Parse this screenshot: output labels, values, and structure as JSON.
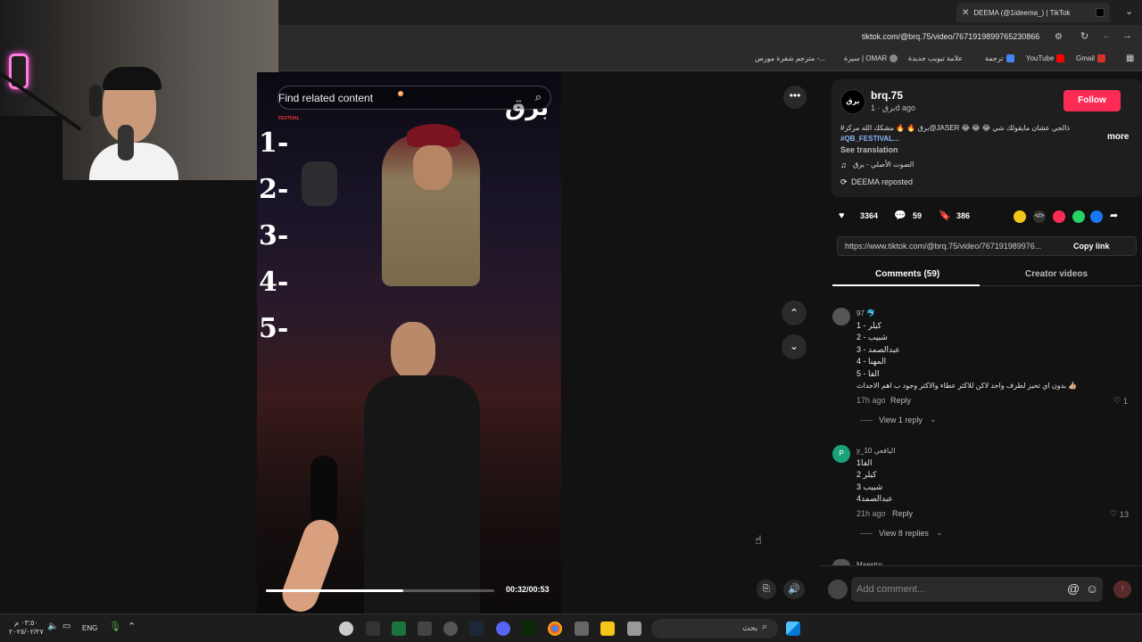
{
  "browser": {
    "tab_title": "DEEMA (@1ideema_) | TikTok",
    "url": "tiktok.com/@brq.75/video/7671919899765230866",
    "bookmarks": [
      "Gmail",
      "YouTube",
      "ترجمة",
      "علامة تبويب جديدة",
      "سيرة | OMAR",
      "مترجم شفرة مورس -..."
    ]
  },
  "video": {
    "search_placeholder": "Find related content",
    "numbers": [
      "1-",
      "2-",
      "3-",
      "4-",
      "5-"
    ],
    "festival_label": "FESTIVAL",
    "watermark": "برق",
    "time": "00:32/00:53",
    "progress": 0.6
  },
  "post": {
    "username": "brq.75",
    "display": "برق · 1d ago",
    "follow_label": "Follow",
    "caption": "#برق 🔥 🔥 مشكك الله مركز@JASER 😂 😂 😂 ذالجي عشان مايقولك شي",
    "hashtag": "#QB_FESTIVAL...",
    "more_label": "more",
    "see_translation": "See translation",
    "sound": "الصوت الأصلي - برق",
    "reposted": "DEEMA reposted",
    "likes": "3364",
    "comments": "59",
    "saves": "386",
    "link": "https://www.tiktok.com/@brq.75/video/767191989976...",
    "copy_link": "Copy link",
    "tab_comments": "Comments (59)",
    "tab_creator": "Creator videos"
  },
  "comments": [
    {
      "user": "97 🐬",
      "lines": [
        "1 - كيلر",
        "2 - شبيب",
        "3 - عبدالصمد",
        "4 - المهنا",
        "5 - الفا",
        "بدون اي تحيز لطرف واحد لاكن للاكثر عطاء والاكثر وجود ب اهم الاحداث 👍🏼"
      ],
      "time": "17h ago",
      "reply": "Reply",
      "likes": "1",
      "view_replies": "View 1 reply"
    },
    {
      "user": "y_10 اليافعي",
      "lines": [
        "1الفا",
        "2 كيلر",
        "3 شبيب",
        "4عبدالصمد"
      ],
      "time": "21h ago",
      "reply": "Reply",
      "likes": "13",
      "view_replies": "View 8 replies"
    }
  ],
  "next_commenter": "Maestro",
  "add_comment_placeholder": "Add comment...",
  "taskbar": {
    "search_placeholder": "بحث",
    "lang": "ENG",
    "time": "٠٣:٥٠ م",
    "date": "٢٠٢٥/٠٢/٢٧"
  },
  "colors": {
    "follow": "#fe2c55",
    "accent_link": "#8ab4f8",
    "page_bg": "#121212"
  }
}
